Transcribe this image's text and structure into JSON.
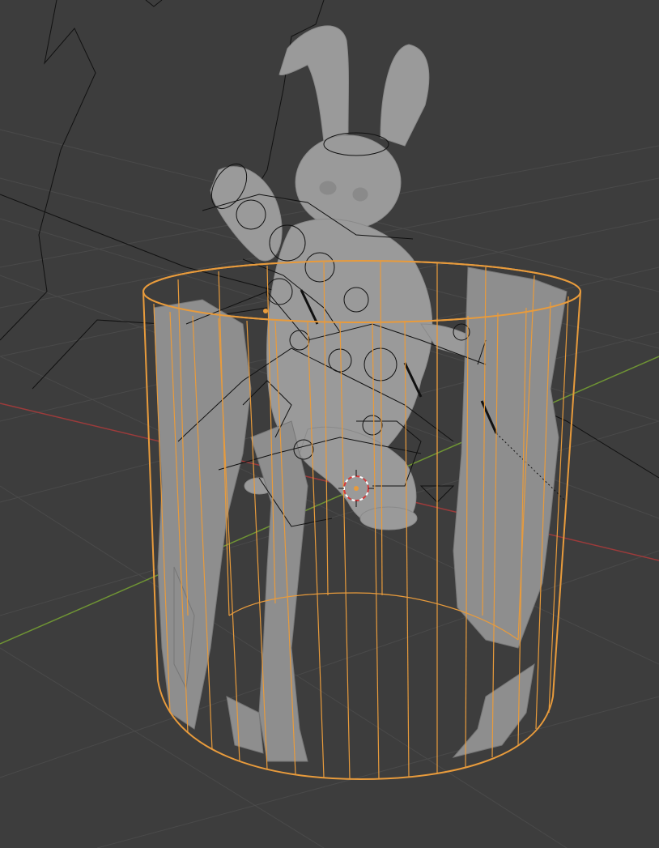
{
  "viewport": {
    "background_color": "#3d3d3d",
    "grid_color": "#4a4a4a",
    "axis_x_color": "#9c3b3b",
    "axis_y_color": "#6f9434",
    "selection_color": "#e89b3c",
    "mesh_color": "#9a9a9a",
    "mesh_dark_color": "#7a7a7a",
    "rig_line_color": "#111111",
    "cursor_color": "#d63a3a"
  },
  "scene": {
    "objects": [
      {
        "name": "rabbit-character-mesh",
        "selected": false
      },
      {
        "name": "cylinder-object",
        "selected": true
      },
      {
        "name": "armature-rig",
        "selected": false
      }
    ],
    "icons": [
      "3d-cursor-icon",
      "origin-dot-icon"
    ]
  }
}
